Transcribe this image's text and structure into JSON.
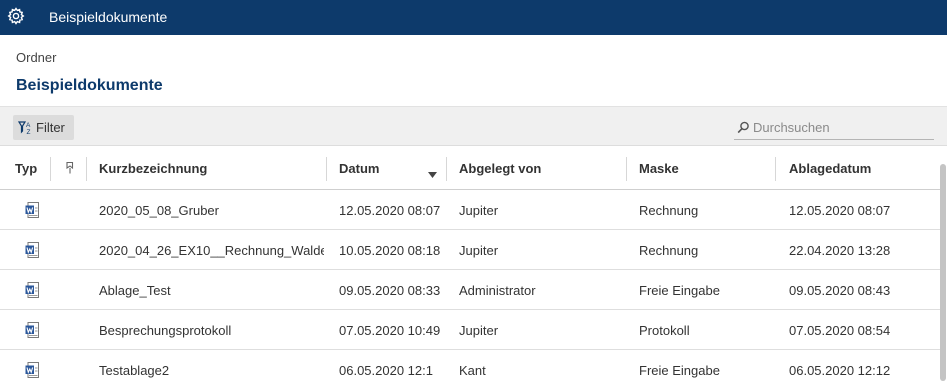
{
  "app": {
    "icon": "gear-icon",
    "title": "Beispieldokumente",
    "bar_color": "#0d3a6b"
  },
  "breadcrumb": "Ordner",
  "page_title": "Beispieldokumente",
  "toolbar": {
    "filter_icon": "filter-icon",
    "filter_label": "Filter",
    "search_icon": "search-icon",
    "search_placeholder": "Durchsuchen"
  },
  "table": {
    "columns": {
      "typ": "Typ",
      "pin": "pin-icon",
      "kurz": "Kurzbezeichnung",
      "datum": "Datum",
      "abgelegt": "Abgelegt von",
      "maske": "Maske",
      "ablage": "Ablagedatum"
    },
    "sort": {
      "column": "Datum",
      "direction": "descending"
    },
    "rows": [
      {
        "icon": "word-document-icon",
        "kurz": "2020_05_08_Gruber",
        "datum": "12.05.2020 08:07",
        "abgelegt": "Jupiter",
        "maske": "Rechnung",
        "ablage": "12.05.2020 08:07"
      },
      {
        "icon": "word-document-icon",
        "kurz": "2020_04_26_EX10__Rechnung_Walde",
        "datum": "10.05.2020 08:18",
        "abgelegt": "Jupiter",
        "maske": "Rechnung",
        "ablage": "22.04.2020 13:28"
      },
      {
        "icon": "word-document-icon",
        "kurz": "Ablage_Test",
        "datum": "09.05.2020 08:33",
        "abgelegt": "Administrator",
        "maske": "Freie Eingabe",
        "ablage": "09.05.2020 08:43"
      },
      {
        "icon": "word-document-icon",
        "kurz": "Besprechungsprotokoll",
        "datum": "07.05.2020 10:49",
        "abgelegt": "Jupiter",
        "maske": "Protokoll",
        "ablage": "07.05.2020 08:54"
      },
      {
        "icon": "word-document-icon",
        "kurz": "Testablage2",
        "datum": "06.05.2020 12:1",
        "abgelegt": "Kant",
        "maske": "Freie Eingabe",
        "ablage": "06.05.2020 12:12"
      }
    ]
  }
}
